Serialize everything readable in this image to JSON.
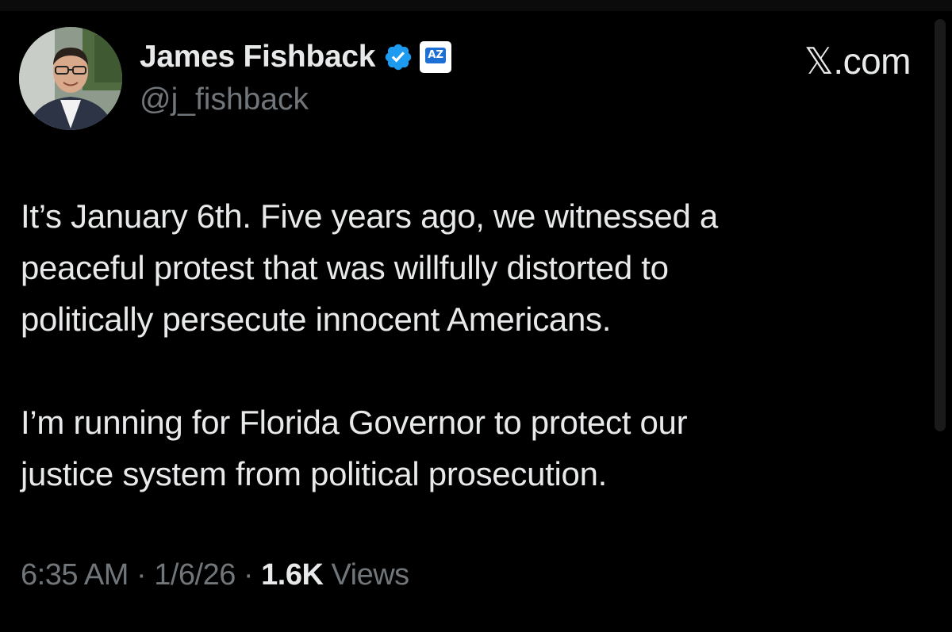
{
  "author": {
    "display_name": "James Fishback",
    "handle": "@j_fishback",
    "verified_icon": "blue-verified-badge",
    "affiliation_icon": "AZ",
    "avatar": "profile-photo"
  },
  "brand": {
    "x_letter": "𝕏",
    "label": ".com"
  },
  "tweet": {
    "paragraph_1": "It’s January 6th. Five years ago, we witnessed a\npeaceful protest that was willfully distorted to\npolitically persecute innocent Americans.",
    "paragraph_2": "I’m running for Florida Governor to protect our\njustice system from political prosecution."
  },
  "meta": {
    "time": "6:35 AM",
    "separator": "·",
    "date": "1/6/26",
    "views_count": "1.6K",
    "views_label": "Views"
  },
  "colors": {
    "background": "#000000",
    "primary_text": "#e7e9ea",
    "secondary_text": "#71767b",
    "verified_blue": "#1d9bf0"
  }
}
